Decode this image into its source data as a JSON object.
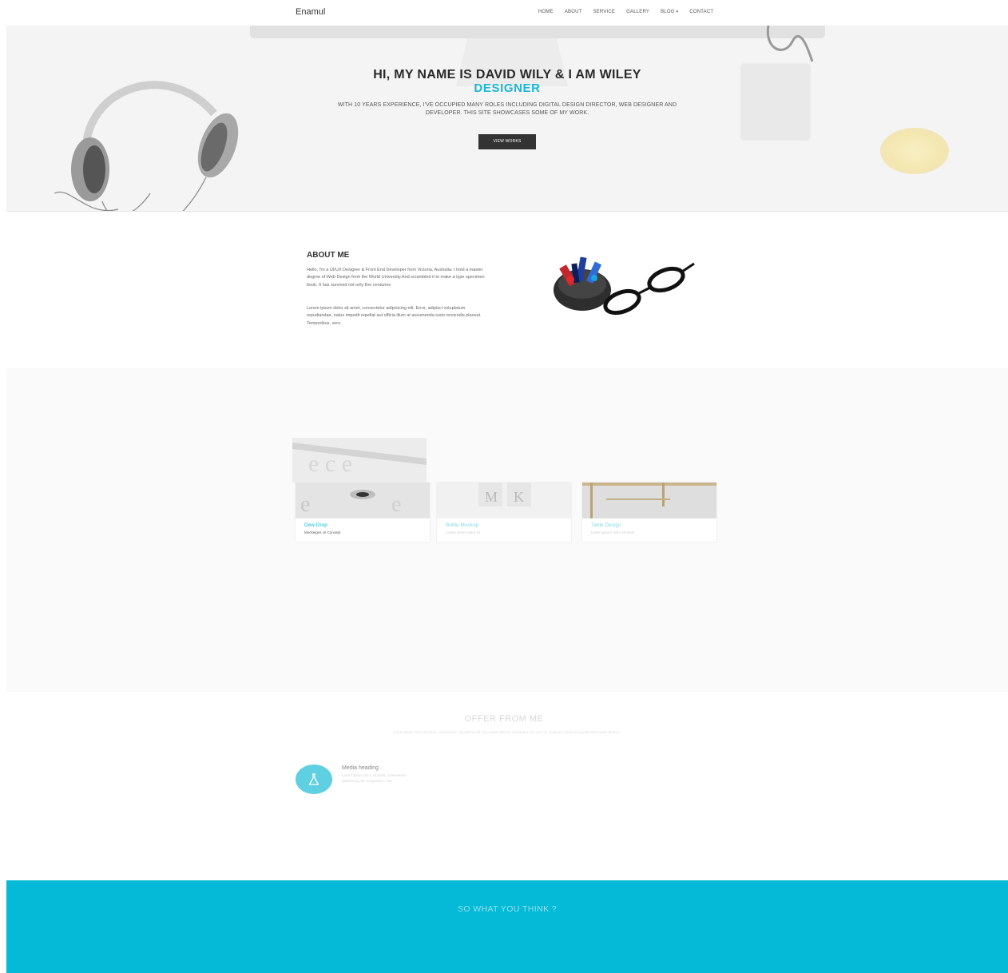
{
  "navbar": {
    "brand": "Enamul",
    "items": [
      {
        "label": "HOME"
      },
      {
        "label": "ABOUT"
      },
      {
        "label": "SERVICE"
      },
      {
        "label": "GALLERY"
      },
      {
        "label": "BLOG"
      },
      {
        "label": "CONTACT"
      }
    ]
  },
  "hero": {
    "title": "HI, MY NAME IS DAVID WILY & I AM WILEY",
    "subtitle": "DESIGNER",
    "description": "WITH 10 YEARS EXPERIENCE, I'VE OCCUPIED MANY ROLES INCLUDING DIGITAL DESIGN DIRECTOR, WEB DESIGNER AND DEVELOPER. THIS SITE SHOWCASES SOME OF MY WORK.",
    "button_label": "VIEW WORKS"
  },
  "about": {
    "title": "ABOUT ME",
    "paragraph1": "Hello, I'm a UI/UX Designer & Front End Developer from Victoria, Australia. I hold a master degree of Web Design from the World University.And scrambled it to make a type specimen book. It has survived not only five centuries",
    "paragraph2": "Lorem ipsum dolor sit amet, consectetur adipisicing elit. Error, adipisci voluptatum repudiandae, natus impedit repellat aut officia illum at assumenda iusto reiciendis placeat. Temporibus, vero."
  },
  "works": {
    "cards": [
      {
        "title": "Dew Drop",
        "subtitle": "Mockeigns UI Concept"
      },
      {
        "title": "Bottle Mockup",
        "subtitle": "Lorem ipsum dolor sit"
      },
      {
        "title": "Table Design",
        "subtitle": "Lorem ipsum dolor sit amet"
      }
    ]
  },
  "offer": {
    "title": "OFFER FROM ME",
    "description": "Lorem ipsum dolor sit amet, consectetur adipisicing elit. Nec quasi dolores numquam sint vero ex, tempore commodi repellendus quas laborum.",
    "media": {
      "heading": "Media heading",
      "text": "Lorem ipsum dolor sit amet, consectetur adipisicing elit. Voluptatum, sint."
    }
  },
  "footer": {
    "text": "SO WHAT YOU THINK ?"
  },
  "colors": {
    "accent": "#1ab7d4",
    "footer_bg": "#05bad6",
    "button_bg": "#333333"
  }
}
